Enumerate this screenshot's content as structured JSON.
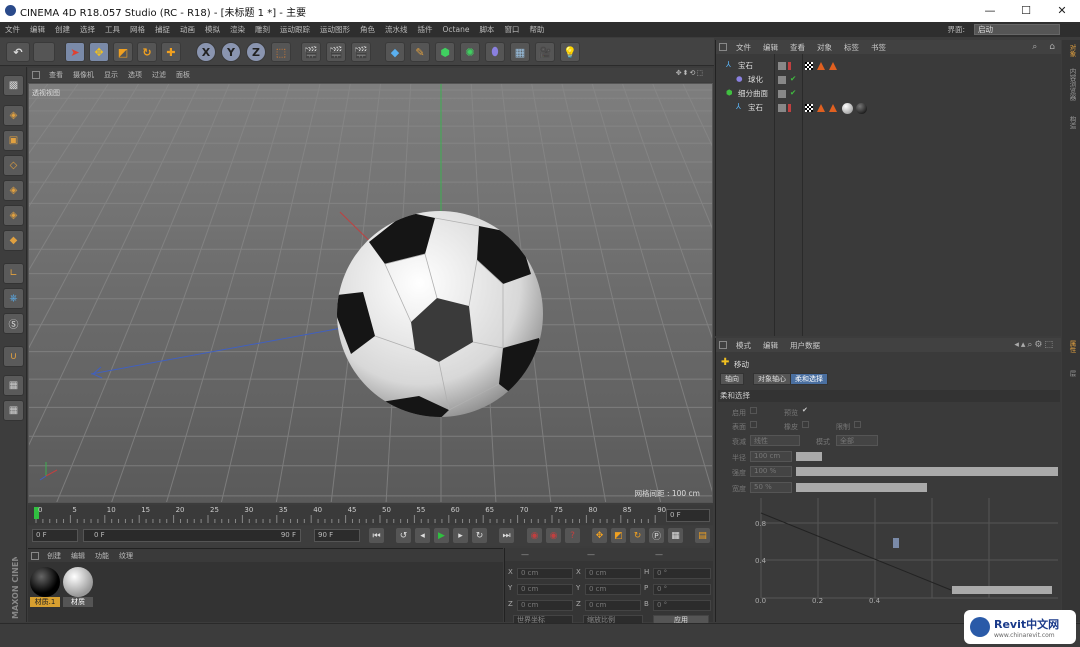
{
  "window": {
    "title": "CINEMA 4D R18.057 Studio (RC - R18) - [未标题 1 *] - 主要",
    "minimize": "—",
    "maximize": "☐",
    "close": "✕"
  },
  "menu": [
    "文件",
    "编辑",
    "创建",
    "选择",
    "工具",
    "网格",
    "捕捉",
    "动画",
    "模拟",
    "渲染",
    "雕刻",
    "运动跟踪",
    "运动图形",
    "角色",
    "流水线",
    "插件",
    "Octane",
    "脚本",
    "窗口",
    "帮助"
  ],
  "layout": {
    "label": "界面:",
    "value": "启动"
  },
  "viewport": {
    "menu": [
      "查看",
      "摄像机",
      "显示",
      "选项",
      "过滤",
      "面板"
    ],
    "label": "透视视图",
    "grid_info": "网格间距 : 100 cm",
    "nav": "✥⬍⟲⬚"
  },
  "timeline": {
    "ticks": [
      "0",
      "5",
      "10",
      "15",
      "20",
      "25",
      "30",
      "35",
      "40",
      "45",
      "50",
      "55",
      "60",
      "65",
      "70",
      "75",
      "80",
      "85",
      "90"
    ],
    "end_frame": "0 F"
  },
  "transport": {
    "start": "0 F",
    "range_start": "0 F",
    "range_end": "90 F",
    "end": "90 F"
  },
  "materials": {
    "menu": [
      "创建",
      "编辑",
      "功能",
      "纹理"
    ],
    "items": [
      {
        "name": "材质.1"
      },
      {
        "name": "材质"
      }
    ]
  },
  "coords": {
    "header": [
      "—",
      "—",
      "—"
    ],
    "rows": [
      {
        "a": "X",
        "av": "0 cm",
        "b": "X",
        "bv": "0 cm",
        "c": "H",
        "cv": "0 °"
      },
      {
        "a": "Y",
        "av": "0 cm",
        "b": "Y",
        "bv": "0 cm",
        "c": "P",
        "cv": "0 °"
      },
      {
        "a": "Z",
        "av": "0 cm",
        "b": "Z",
        "bv": "0 cm",
        "c": "B",
        "cv": "0 °"
      }
    ],
    "mode1": "世界坐标",
    "mode2": "缩放比例",
    "apply": "应用"
  },
  "objects": {
    "menu": [
      "文件",
      "编辑",
      "查看",
      "对象",
      "标签",
      "书签"
    ],
    "rows": [
      {
        "name": "宝石",
        "indent": 0
      },
      {
        "name": "球化",
        "indent": 1
      },
      {
        "name": "细分曲面",
        "indent": 0
      },
      {
        "name": "宝石",
        "indent": 1
      }
    ]
  },
  "attributes": {
    "menu": [
      "模式",
      "编辑",
      "用户数据"
    ],
    "tool": "移动",
    "tabs": [
      "轴向",
      "对象轴心",
      "柔和选择"
    ],
    "section": "柔和选择",
    "fields": {
      "enable": "启用",
      "preview": "预览",
      "surface": "表面",
      "rubber": "橡皮",
      "restrict": "限制",
      "falloff": "衰减",
      "falloff_val": "线性",
      "mode": "模式",
      "mode_val": "全部",
      "radius": "半径",
      "radius_val": "100 cm",
      "strength": "强度",
      "strength_val": "100 %",
      "width": "宽度",
      "width_val": "50 %"
    },
    "graph": {
      "y_ticks": [
        "0.8",
        "0.4"
      ],
      "x_ticks": [
        "0.0",
        "0.2",
        "0.4"
      ]
    }
  },
  "side_tabs": [
    "对象",
    "内容浏览器",
    "构造",
    "属性",
    "层"
  ],
  "brand": {
    "vertical": "MAXON CINEMA 4D",
    "watermark": "Revit中文网",
    "watermark_url": "www.chinarevit.com"
  }
}
